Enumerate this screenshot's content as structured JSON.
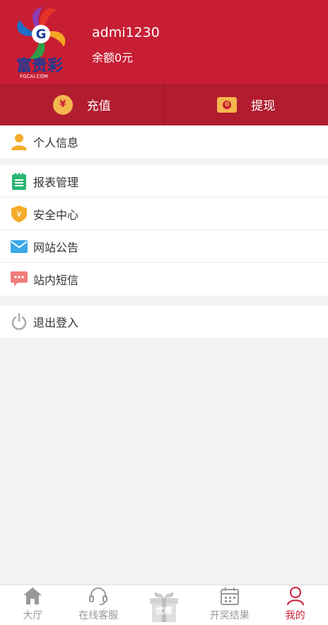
{
  "header": {
    "logo_text": "富贵彩",
    "logo_site": "FGCAI.COM",
    "username": "admi1230",
    "balance": "余额0元"
  },
  "actions": {
    "recharge_label": "充值",
    "recharge_icon_glyph": "¥",
    "withdraw_label": "提现",
    "withdraw_icon_glyph": "0"
  },
  "menu": {
    "profile": "个人信息",
    "reports": "报表管理",
    "security": "安全中心",
    "notices": "网站公告",
    "messages": "站内短信",
    "logout": "退出登入"
  },
  "tabbar": {
    "hall": "大厅",
    "service": "在线客服",
    "promo": "优惠",
    "results": "开奖结果",
    "mine": "我的"
  },
  "colors": {
    "brand_red": "#c71e34",
    "action_bar": "#b11c2f",
    "gold": "#f4b64e"
  }
}
